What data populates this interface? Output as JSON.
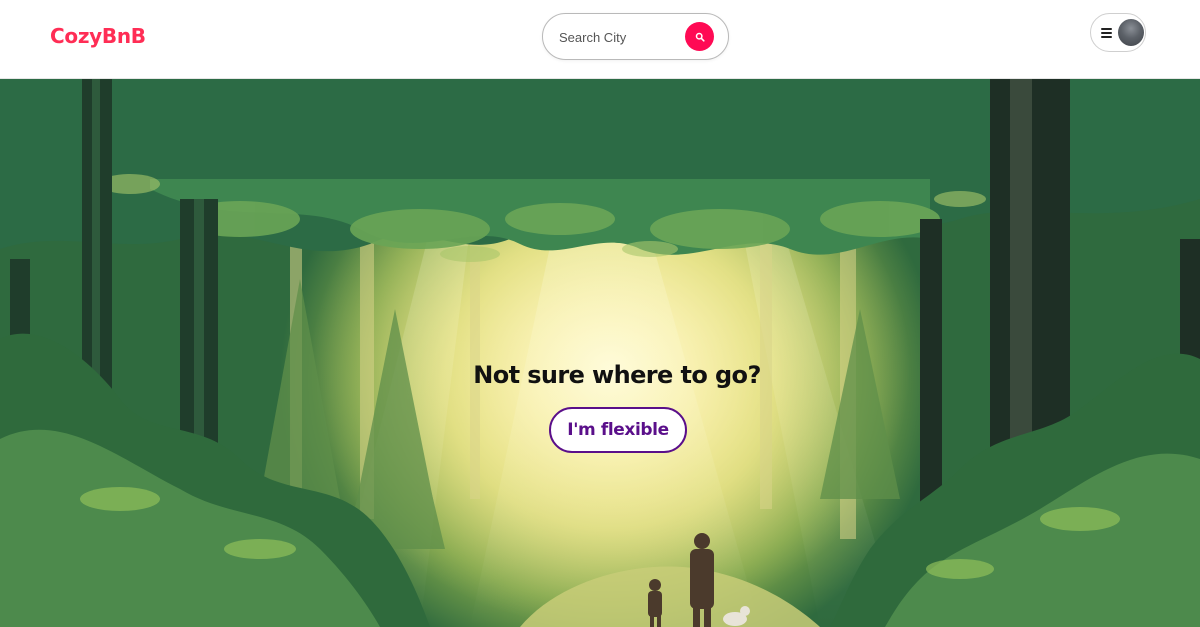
{
  "header": {
    "logo_text": "CozyBnB",
    "search": {
      "placeholder": "Search City",
      "value": "",
      "button_icon": "search-icon"
    },
    "user_menu": {
      "menu_icon": "hamburger-menu-icon",
      "avatar_icon": "avatar"
    }
  },
  "hero": {
    "background": "forest-illustration",
    "title": "Not sure where to go?",
    "button_label": "I'm flexible"
  },
  "colors": {
    "brand": "#ff2d55",
    "search_button": "#ff0a54",
    "accent": "#5a0f8a"
  }
}
